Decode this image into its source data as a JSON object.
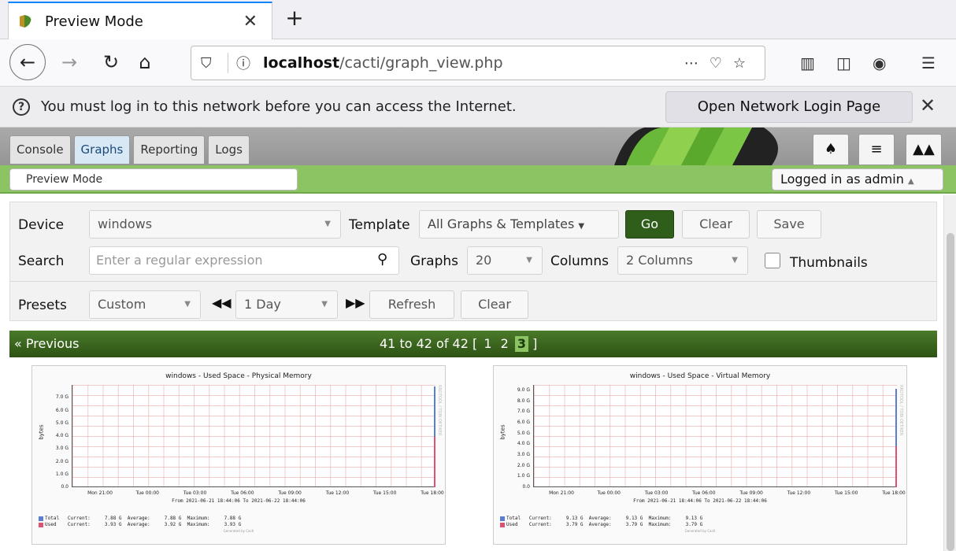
{
  "browser": {
    "tab_title": "Preview Mode",
    "url_host": "localhost",
    "url_path": "/cacti/graph_view.php"
  },
  "notification": {
    "message": "You must log in to this network before you can access the Internet.",
    "button_label": "Open Network Login Page"
  },
  "cacti": {
    "tabs": [
      "Console",
      "Graphs",
      "Reporting",
      "Logs"
    ],
    "active_tab": "Graphs",
    "breadcrumb": "Preview Mode",
    "user_label": "Logged in as admin"
  },
  "filter": {
    "device_label": "Device",
    "device_value": "windows",
    "template_label": "Template",
    "template_value": "All Graphs & Templates",
    "go_label": "Go",
    "clear_label": "Clear",
    "save_label": "Save",
    "search_label": "Search",
    "search_placeholder": "Enter a regular expression",
    "graphs_label": "Graphs",
    "graphs_value": "20",
    "columns_label": "Columns",
    "columns_value": "2 Columns",
    "thumbnails_label": "Thumbnails",
    "presets_label": "Presets",
    "presets_value": "Custom",
    "timespan_value": "1 Day",
    "refresh_label": "Refresh",
    "clear2_label": "Clear"
  },
  "paging": {
    "previous_label": "Previous",
    "summary": "41 to 42 of 42 [",
    "pages": [
      "1",
      "2",
      "3"
    ],
    "current_page": "3",
    "close_bracket": "]"
  },
  "graphs": [
    {
      "title": "windows - Used Space - Physical Memory",
      "ylabel": "bytes",
      "yticks": [
        "7.0 G",
        "6.0 G",
        "5.0 G",
        "4.0 G",
        "3.0 G",
        "2.0 G",
        "1.0 G",
        "0.0"
      ],
      "xticks": [
        "Mon 21:00",
        "Tue 00:00",
        "Tue 03:00",
        "Tue 06:00",
        "Tue 09:00",
        "Tue 12:00",
        "Tue 15:00",
        "Tue 18:00"
      ],
      "fromto": "From 2021-06-21 18:44:06 To 2021-06-22 18:44:06",
      "legend_total": "Total   Current:     7.88 G  Average:     7.88 G  Maximum:     7.88 G",
      "legend_used": "Used    Current:     3.93 G  Average:     3.92 G  Maximum:     3.93 G",
      "credit": "Generated by Cacti",
      "side_text": "RRDTOOL / TOBI OETIKER"
    },
    {
      "title": "windows - Used Space - Virtual Memory",
      "ylabel": "bytes",
      "yticks": [
        "9.0 G",
        "8.0 G",
        "7.0 G",
        "6.0 G",
        "5.0 G",
        "4.0 G",
        "3.0 G",
        "2.0 G",
        "1.0 G",
        "0.0"
      ],
      "xticks": [
        "Mon 21:00",
        "Tue 00:00",
        "Tue 03:00",
        "Tue 06:00",
        "Tue 09:00",
        "Tue 12:00",
        "Tue 15:00",
        "Tue 18:00"
      ],
      "fromto": "From 2021-06-21 18:44:06 To 2021-06-22 18:44:06",
      "legend_total": "Total   Current:     9.13 G  Average:     9.13 G  Maximum:     9.13 G",
      "legend_used": "Used    Current:     3.79 G  Average:     3.79 G  Maximum:     3.79 G",
      "credit": "Generated by Cacti",
      "side_text": "RRDTOOL / TOBI OETIKER"
    }
  ],
  "chart_data": [
    {
      "type": "area",
      "title": "windows - Used Space - Physical Memory",
      "xlabel": "",
      "ylabel": "bytes",
      "ylim": [
        0,
        8
      ],
      "series": [
        {
          "name": "Total",
          "color": "#5b7fd0",
          "current": 7.88,
          "average": 7.88,
          "maximum": 7.88
        },
        {
          "name": "Used",
          "color": "#e05070",
          "current": 3.93,
          "average": 3.92,
          "maximum": 3.93
        }
      ]
    },
    {
      "type": "area",
      "title": "windows - Used Space - Virtual Memory",
      "xlabel": "",
      "ylabel": "bytes",
      "ylim": [
        0,
        9.5
      ],
      "series": [
        {
          "name": "Total",
          "color": "#5b7fd0",
          "current": 9.13,
          "average": 9.13,
          "maximum": 9.13
        },
        {
          "name": "Used",
          "color": "#e05070",
          "current": 3.79,
          "average": 3.79,
          "maximum": 3.79
        }
      ]
    }
  ]
}
